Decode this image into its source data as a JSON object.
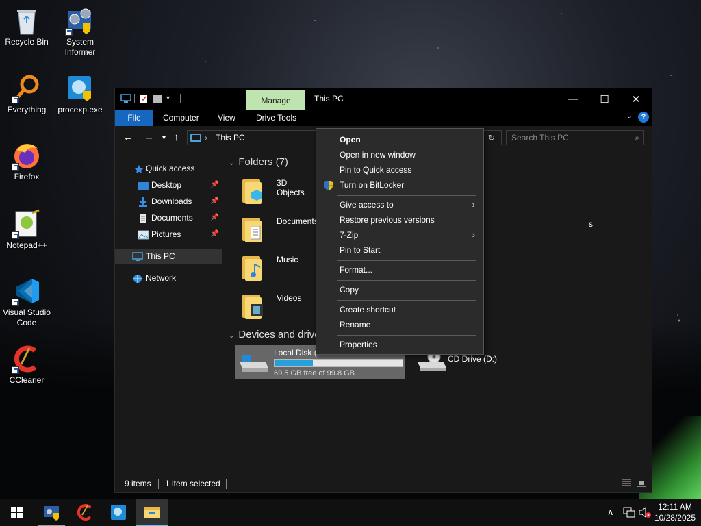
{
  "desktop": {
    "icons": [
      {
        "label": "Recycle Bin"
      },
      {
        "label": "System Informer"
      },
      {
        "label": "Everything"
      },
      {
        "label": "procexp.exe"
      },
      {
        "label": "Firefox"
      },
      {
        "label": "Notepad++"
      },
      {
        "label": "Visual Studio Code"
      },
      {
        "label": "CCleaner"
      }
    ]
  },
  "window": {
    "title": "This PC",
    "contextual_tab": "Manage",
    "ribbon_tabs": [
      "File",
      "Computer",
      "View",
      "Drive Tools"
    ],
    "address": "This PC",
    "search_placeholder": "Search This PC",
    "nav": {
      "quick_access": "Quick access",
      "items": [
        "Desktop",
        "Downloads",
        "Documents",
        "Pictures"
      ],
      "this_pc": "This PC",
      "network": "Network"
    },
    "folders_header": "Folders (7)",
    "folders": [
      "3D Objects",
      "Documents",
      "Music",
      "Videos"
    ],
    "folders_partial_right": "s",
    "devices_header": "Devices and drive",
    "drives": [
      {
        "name": "Local Disk (C",
        "free": "69.5 GB free of 99.8 GB",
        "used_fraction": 0.3
      },
      {
        "name": "CD Drive (D:)"
      }
    ],
    "status": {
      "items": "9 items",
      "selected": "1 item selected"
    }
  },
  "context_menu": {
    "items": [
      {
        "label": "Open",
        "bold": true
      },
      {
        "label": "Open in new window"
      },
      {
        "label": "Pin to Quick access"
      },
      {
        "label": "Turn on BitLocker",
        "icon": "uac-shield-icon"
      },
      {
        "label": "Give access to",
        "submenu": true
      },
      {
        "label": "Restore previous versions"
      },
      {
        "label": "7-Zip",
        "submenu": true
      },
      {
        "label": "Pin to Start"
      },
      {
        "label": "Format..."
      },
      {
        "label": "Copy"
      },
      {
        "label": "Create shortcut"
      },
      {
        "label": "Rename"
      },
      {
        "label": "Properties"
      }
    ]
  },
  "taskbar": {
    "clock_time": "12:11 AM",
    "clock_date": "10/28/2025"
  },
  "colors": {
    "accent": "#1667c0",
    "manage_tab": "#bfe4b0",
    "drive_fill": "#26a0da"
  }
}
